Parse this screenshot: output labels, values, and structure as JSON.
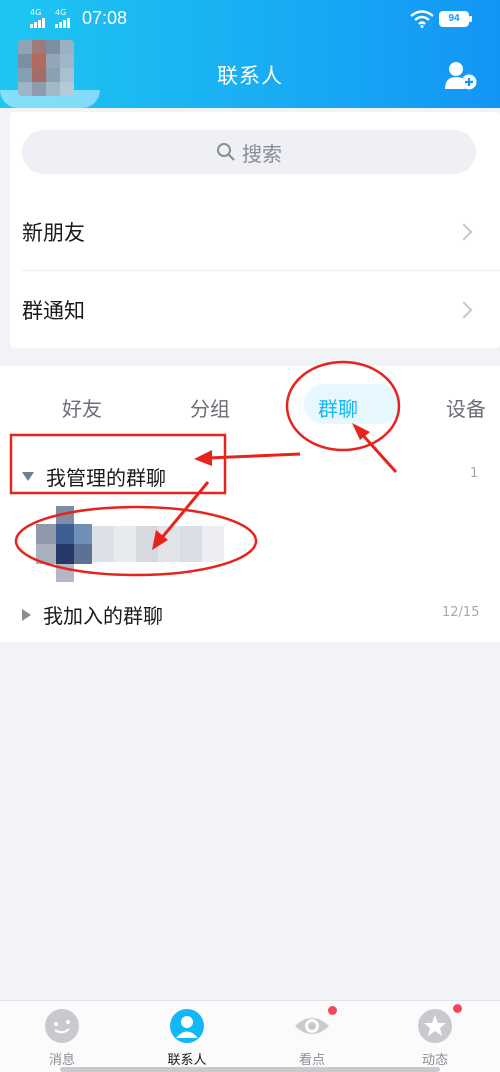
{
  "status_bar": {
    "signal_1": "4G",
    "signal_2": "4G",
    "time": "07:08",
    "battery": "94"
  },
  "header": {
    "title": "联系人"
  },
  "search": {
    "placeholder": "搜索"
  },
  "menu": [
    {
      "label": "新朋友"
    },
    {
      "label": "群通知"
    }
  ],
  "tabs": [
    {
      "label": "好友"
    },
    {
      "label": "分组"
    },
    {
      "label": "群聊",
      "active": true
    },
    {
      "label": "设备"
    }
  ],
  "groups": {
    "managed": {
      "label": "我管理的群聊",
      "count": "1"
    },
    "joined": {
      "label": "我加入的群聊",
      "count": "12/15"
    }
  },
  "bottom_nav": [
    {
      "label": "消息",
      "icon": "message-icon"
    },
    {
      "label": "联系人",
      "icon": "contacts-icon",
      "active": true
    },
    {
      "label": "看点",
      "icon": "eye-icon",
      "badge": true
    },
    {
      "label": "动态",
      "icon": "star-icon",
      "badge": true
    }
  ],
  "colors": {
    "accent": "#12b7f5",
    "annotation": "#e8231d"
  }
}
